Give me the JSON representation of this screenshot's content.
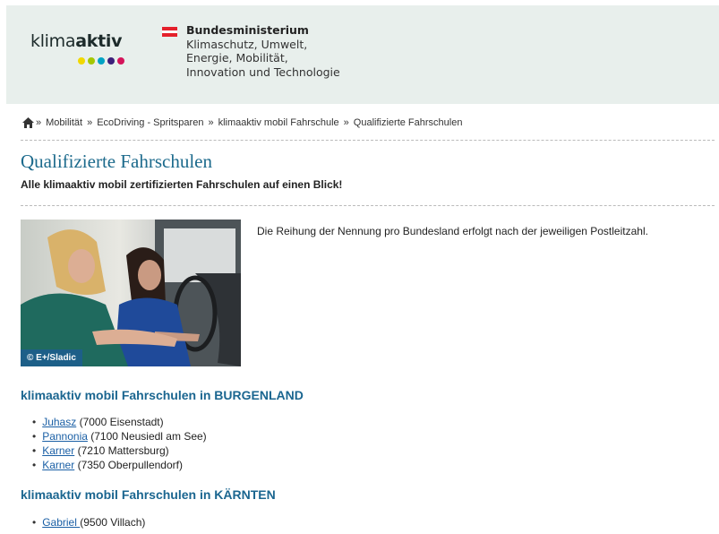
{
  "header": {
    "logo_text_light": "klima",
    "logo_text_bold": "aktiv",
    "logo_dots": [
      "#f1d800",
      "#a4c700",
      "#00a3c4",
      "#3c1f7a",
      "#d4145a"
    ],
    "ministry": {
      "title": "Bundesministerium",
      "lines": [
        "Klimaschutz, Umwelt,",
        "Energie, Mobilität,",
        "Innovation und Technologie"
      ]
    }
  },
  "breadcrumb": {
    "separator": "»",
    "items": [
      "Mobilität",
      "EcoDriving - Spritsparen",
      "klimaaktiv mobil Fahrschule",
      "Qualifizierte Fahrschulen"
    ]
  },
  "page": {
    "title": "Qualifizierte Fahrschulen",
    "subtitle": "Alle klimaaktiv mobil zertifizierten Fahrschulen auf einen Blick!",
    "intro": "Die Reihung der Nennung pro Bundesland erfolgt nach der jeweiligen Postleitzahl.",
    "photo_credit": "© E+/Sladic"
  },
  "sections": [
    {
      "heading": "klimaaktiv mobil Fahrschulen in BURGENLAND",
      "schools": [
        {
          "name": "Juhasz",
          "location": " (7000 Eisenstadt)"
        },
        {
          "name": "Pannonia",
          "location": " (7100 Neusiedl am See)"
        },
        {
          "name": "Karner",
          "location": " (7210 Mattersburg)"
        },
        {
          "name": "Karner",
          "location": " (7350 Oberpullendorf)"
        }
      ]
    },
    {
      "heading": "klimaaktiv mobil Fahrschulen in KÄRNTEN",
      "schools": [
        {
          "name": "Gabriel ",
          "location": "(9500 Villach)"
        }
      ]
    }
  ]
}
